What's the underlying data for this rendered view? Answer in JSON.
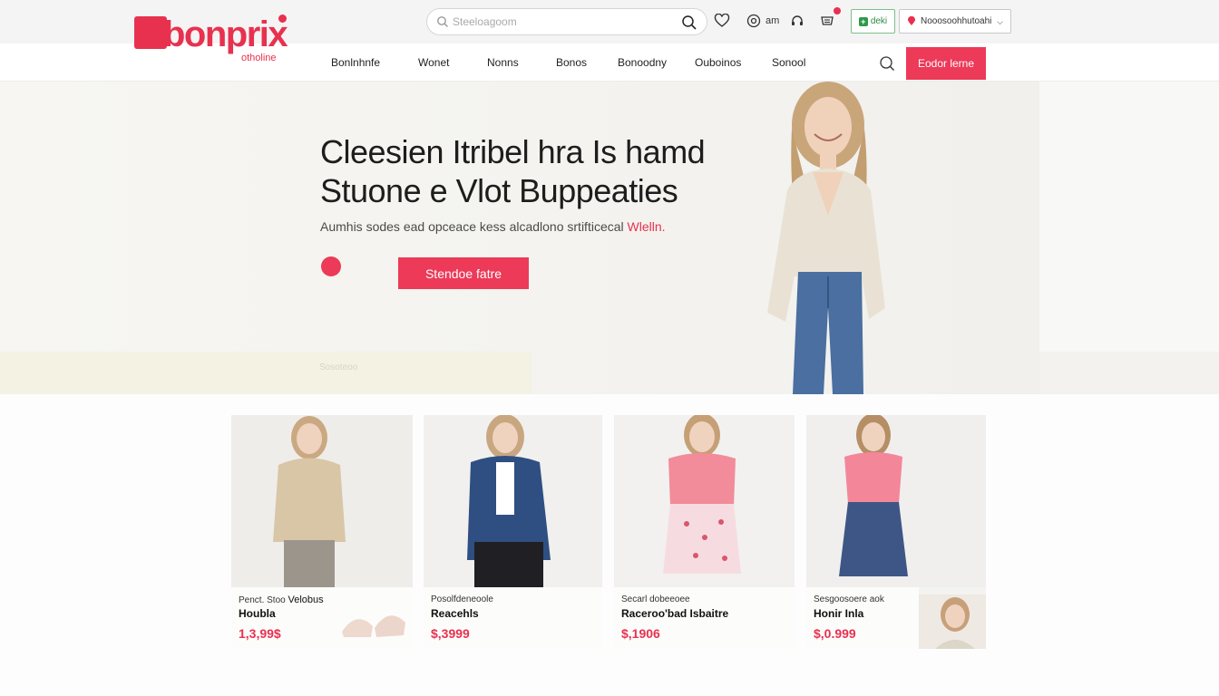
{
  "brand": {
    "logo_text": "bonprix",
    "logo_sub": "otholine",
    "color": "#e8314f"
  },
  "search": {
    "placeholder": "Steeloagoom"
  },
  "header": {
    "account_label": "am",
    "promo_label": "deki",
    "store_select": "Nooosoohhutoahi",
    "icons": [
      "search-icon",
      "heart-icon",
      "account-icon",
      "support-icon",
      "cart-icon"
    ]
  },
  "nav": {
    "items": [
      "Bonlnhnfe",
      "Wonet",
      "Nonns",
      "Bonos",
      "Bonoodny",
      "Ouboinos",
      "Sonool"
    ],
    "cta_label": "Eodor lerne"
  },
  "hero": {
    "title_line1": "Cleesien Itribel hra Is hamd",
    "title_line2": "Stuone e Vlot Buppeaties",
    "subtitle": "Aumhis sodes ead opceace kess alcadlono srtifticecal",
    "subtitle_accent": "Wlelln.",
    "button_label": "Stendoe fatre",
    "band_text": "Sosoteoo"
  },
  "products": [
    {
      "small": "Penct. Stoo",
      "small2": "Velobus",
      "name": "Houbla",
      "price": "1,3,99$"
    },
    {
      "small": "Posolfdeneoole",
      "small2": "",
      "name": "Reacehls",
      "price": "$,3999"
    },
    {
      "small": "Secarl dobeeoee",
      "small2": "",
      "name": "Raceroo'bad Isbaitre",
      "price": "$,1906"
    },
    {
      "small": "Sesgoosoere",
      "small2": "aok",
      "name": "Honir Inla",
      "price": "$,0.999"
    }
  ],
  "colors": {
    "accent": "#ec3a58",
    "green": "#2c9a48"
  }
}
